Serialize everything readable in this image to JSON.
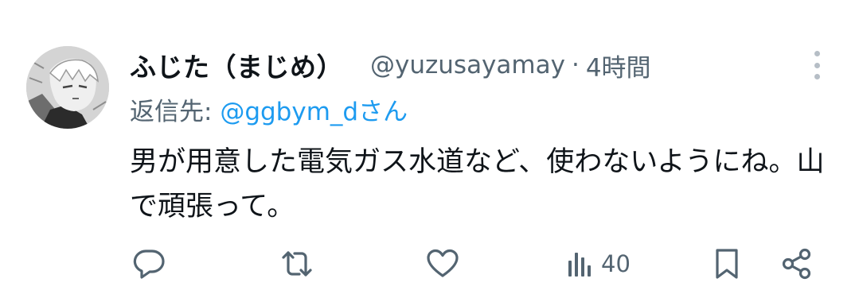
{
  "tweet": {
    "display_name": "ふじた（まじめ）",
    "handle": "@yuzusayamay",
    "separator": "·",
    "time": "4時間",
    "reply_prefix": "返信先: ",
    "reply_to": "@ggbym_dさん",
    "text": "男が用意した電気ガス水道など、使わないようにね。山で頑張って。"
  },
  "actions": {
    "views_count": "40"
  },
  "icons": {
    "reply": "comment-icon",
    "retweet": "retweet-icon",
    "like": "heart-icon",
    "views": "analytics-icon",
    "bookmark": "bookmark-icon",
    "share": "share-icon",
    "more": "more-vertical-icon"
  },
  "colors": {
    "text": "#0f1419",
    "secondary": "#536471",
    "link": "#1d9bf0"
  }
}
